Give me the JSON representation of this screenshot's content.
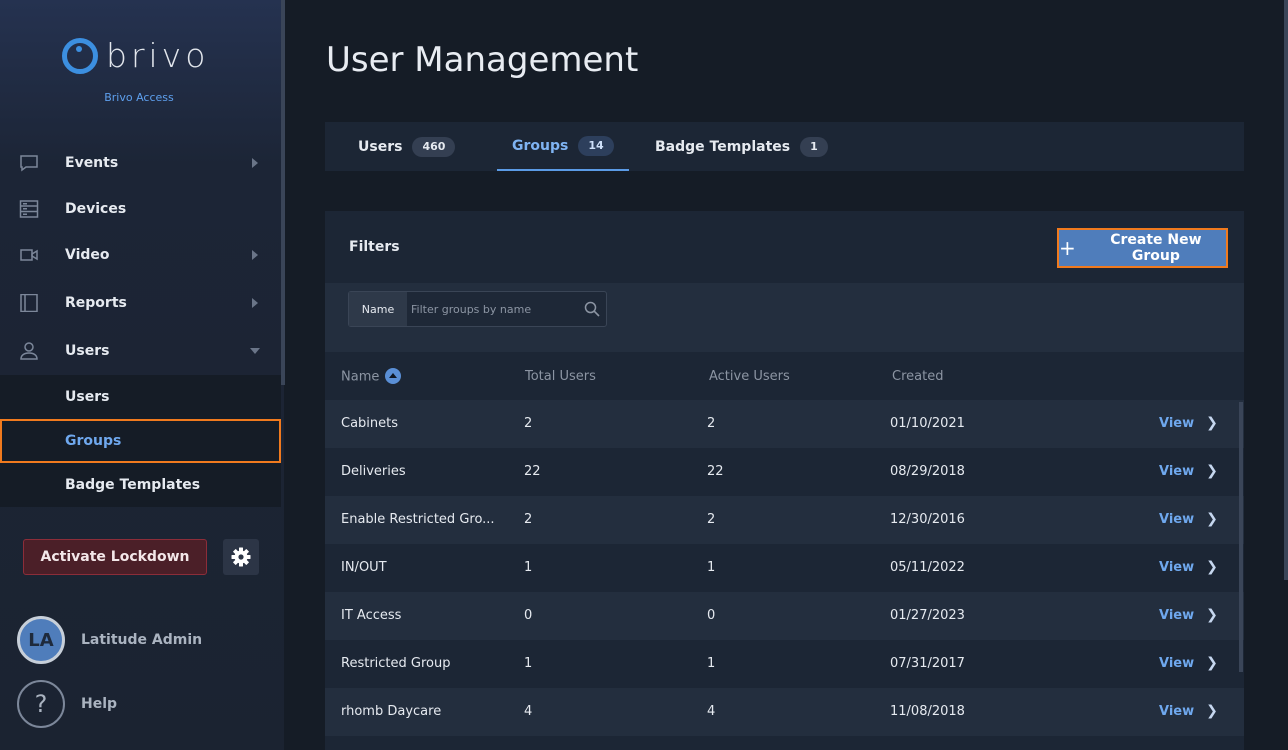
{
  "brand": {
    "logo_text": "brivo",
    "subtitle": "Brivo Access"
  },
  "sidebar": {
    "nav": [
      {
        "label": "Events",
        "icon": "chat-icon",
        "arrow": "right"
      },
      {
        "label": "Devices",
        "icon": "devices-icon",
        "arrow": ""
      },
      {
        "label": "Video",
        "icon": "video-camera-icon",
        "arrow": "right"
      },
      {
        "label": "Reports",
        "icon": "book-icon",
        "arrow": "right"
      },
      {
        "label": "Users",
        "icon": "user-icon",
        "arrow": "down"
      }
    ],
    "subnav": [
      {
        "label": "Users",
        "active": false
      },
      {
        "label": "Groups",
        "active": true
      },
      {
        "label": "Badge Templates",
        "active": false
      }
    ],
    "lockdown_label": "Activate Lockdown",
    "user": {
      "initials": "LA",
      "name": "Latitude Admin"
    },
    "help": {
      "glyph": "?",
      "label": "Help"
    }
  },
  "main": {
    "title": "User Management",
    "tabs": [
      {
        "label": "Users",
        "count": "460",
        "active": false
      },
      {
        "label": "Groups",
        "count": "14",
        "active": true
      },
      {
        "label": "Badge Templates",
        "count": "1",
        "active": false
      }
    ],
    "filters": {
      "title": "Filters",
      "create_label": "Create New Group",
      "name_label": "Name",
      "placeholder": "Filter groups by name"
    },
    "table": {
      "columns": [
        "Name",
        "Total Users",
        "Active Users",
        "Created"
      ],
      "view_label": "View",
      "rows": [
        {
          "name": "Cabinets",
          "total": "2",
          "active": "2",
          "created": "01/10/2021"
        },
        {
          "name": "Deliveries",
          "total": "22",
          "active": "22",
          "created": "08/29/2018"
        },
        {
          "name": "Enable Restricted Gro...",
          "total": "2",
          "active": "2",
          "created": "12/30/2016"
        },
        {
          "name": "IN/OUT",
          "total": "1",
          "active": "1",
          "created": "05/11/2022"
        },
        {
          "name": "IT Access",
          "total": "0",
          "active": "0",
          "created": "01/27/2023"
        },
        {
          "name": "Restricted Group",
          "total": "1",
          "active": "1",
          "created": "07/31/2017"
        },
        {
          "name": "rhomb Daycare",
          "total": "4",
          "active": "4",
          "created": "11/08/2018"
        }
      ]
    }
  },
  "colors": {
    "accent": "#4f7dbb",
    "highlight": "#f07a1e",
    "link": "#6fa8ee",
    "danger_bg": "#4b1f28"
  }
}
